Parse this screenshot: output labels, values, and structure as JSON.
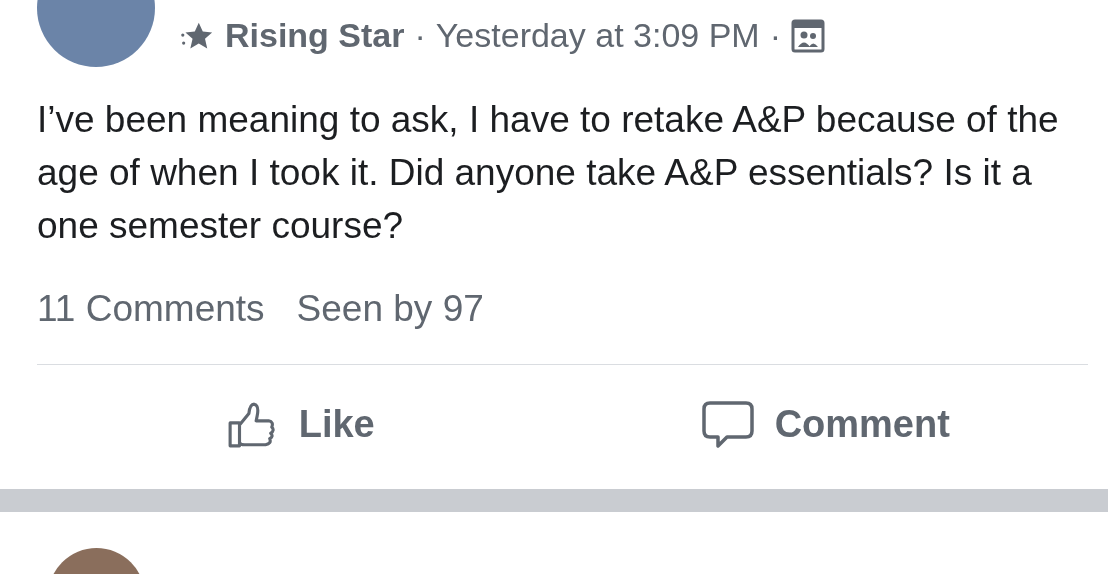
{
  "post": {
    "badge": "Rising Star",
    "separator_1": "·",
    "timestamp": "Yesterday at 3:09 PM",
    "separator_2": "·",
    "text": "I’ve been meaning to ask, I have to retake A&P because of the age of when I took it. Did anyone take A&P essentials? Is it a one semester course?",
    "comments_count": "11 Comments",
    "seen_by": "Seen by 97",
    "actions": [
      {
        "kind": "like",
        "label": "Like"
      },
      {
        "kind": "comment",
        "label": "Comment"
      }
    ]
  }
}
